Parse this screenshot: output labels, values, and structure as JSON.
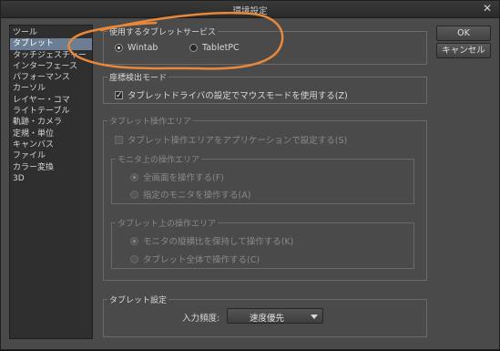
{
  "window": {
    "title": "環境設定"
  },
  "sidebar": {
    "items": [
      {
        "label": "ツール",
        "selected": false
      },
      {
        "label": "タブレット",
        "selected": true
      },
      {
        "label": "タッチジェスチャー",
        "selected": false
      },
      {
        "label": "インターフェース",
        "selected": false
      },
      {
        "label": "パフォーマンス",
        "selected": false
      },
      {
        "label": "カーソル",
        "selected": false
      },
      {
        "label": "レイヤー・コマ",
        "selected": false
      },
      {
        "label": "ライトテーブル",
        "selected": false
      },
      {
        "label": "軌跡・カメラ",
        "selected": false
      },
      {
        "label": "定規・単位",
        "selected": false
      },
      {
        "label": "キャンバス",
        "selected": false
      },
      {
        "label": "ファイル",
        "selected": false
      },
      {
        "label": "カラー変換",
        "selected": false
      },
      {
        "label": "3D",
        "selected": false
      }
    ]
  },
  "buttons": {
    "ok": "OK",
    "cancel": "キャンセル"
  },
  "tablet_service": {
    "legend": "使用するタブレットサービス",
    "options": [
      {
        "label": "Wintab",
        "selected": true
      },
      {
        "label": "TabletPC",
        "selected": false
      }
    ]
  },
  "coordinate_mode": {
    "legend": "座標検出モード",
    "checkbox_label": "タブレットドライバの設定でマウスモードを使用する(Z)",
    "checked": true
  },
  "tablet_area": {
    "legend": "タブレット操作エリア",
    "checkbox_label": "タブレット操作エリアをアプリケーションで設定する(S)",
    "checked": false,
    "monitor_group": {
      "legend": "モニタ上の操作エリア",
      "options": [
        {
          "label": "全画面を操作する(F)",
          "selected": true
        },
        {
          "label": "指定のモニタを操作する(A)",
          "selected": false
        }
      ]
    },
    "tablet_group": {
      "legend": "タブレット上の操作エリア",
      "options": [
        {
          "label": "モニタの縦横比を保持して操作する(K)",
          "selected": true
        },
        {
          "label": "タブレット全体で操作する(C)",
          "selected": false
        }
      ]
    }
  },
  "tablet_settings": {
    "legend": "タブレット設定",
    "input_frequency_label": "入力頻度:",
    "input_frequency_value": "速度優先"
  },
  "colors": {
    "annotation": "#e8883a",
    "selected_item": "#6b7e93"
  }
}
